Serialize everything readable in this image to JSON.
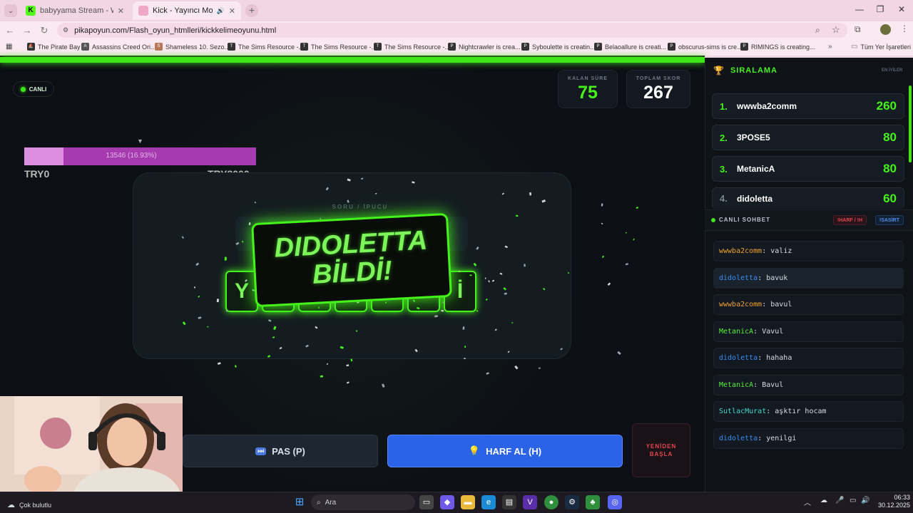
{
  "browser": {
    "tabs": [
      {
        "title": "babyyama Stream - Watch Live",
        "active": false,
        "favicon_color": "#53fc18"
      },
      {
        "title": "Kick - Yayıncı Modu (Kelime",
        "active": true,
        "favicon_color": "#f1a8c8"
      }
    ],
    "url": "pikapoyun.com/Flash_oyun_htmlleri/kickkelimeoyunu.html",
    "bookmarks": [
      {
        "label": "The Pirate Bay",
        "icon": "ship-icon"
      },
      {
        "label": "Assassins Creed Ori...",
        "icon": "creed-icon"
      },
      {
        "label": "Shameless 10. Sezo...",
        "icon": "tv-icon"
      },
      {
        "label": "The Sims Resource -...",
        "icon": "tsr-icon"
      },
      {
        "label": "The Sims Resource -...",
        "icon": "tsr-icon"
      },
      {
        "label": "The Sims Resource -...",
        "icon": "tsr-icon"
      },
      {
        "label": "Nightcrawler is crea...",
        "icon": "patreon-icon"
      },
      {
        "label": "Syboulette is creatin...",
        "icon": "patreon-icon"
      },
      {
        "label": "Belaoallure is creati...",
        "icon": "patreon-icon"
      },
      {
        "label": "obscurus-sims is cre...",
        "icon": "patreon-icon"
      },
      {
        "label": "RIMINGS is creating...",
        "icon": "patreon-icon"
      }
    ],
    "all_bookmarks": "Tüm Yer İşaretleri"
  },
  "game": {
    "live_label": "CANLI",
    "remaining_time": {
      "label": "KALAN SÜRE",
      "value": "75"
    },
    "total_score": {
      "label": "TOPLAM SKOR",
      "value": "267"
    },
    "goal": {
      "text": "13546 (16.93%)",
      "min": "TRY0",
      "max": "TRY8000",
      "progress": 0.1693
    },
    "hint_label": "SORU / İPUCU",
    "letters": [
      "Y",
      "",
      "",
      "",
      "",
      "",
      "İ"
    ],
    "banner": {
      "line1": "DIDOLETTA",
      "line2": "BİLDİ!"
    },
    "pass_button": "PAS (P)",
    "hint_button": "HARF AL (H)",
    "restart_button": {
      "line1": "YENİDEN",
      "line2": "BAŞLA"
    },
    "colors": {
      "accent": "#45f21c",
      "hint_button": "#2a62e8",
      "restart": "#e2464f"
    }
  },
  "leaderboard": {
    "title": "SIRALAMA",
    "subtitle": "EN İYİLER",
    "rows": [
      {
        "rank": "1.",
        "name": "wwwba2comm",
        "score": "260"
      },
      {
        "rank": "2.",
        "name": "3POSE5",
        "score": "80"
      },
      {
        "rank": "3.",
        "name": "MetanicA",
        "score": "80"
      },
      {
        "rank": "4.",
        "name": "didoletta",
        "score": "60"
      }
    ]
  },
  "chat": {
    "title": "CANLI SOHBET",
    "chip1": "!HARF / !H",
    "chip2": "!SASİRT",
    "messages": [
      {
        "user": "wwwba2comm",
        "text": ": valiz",
        "color": "#f0a132"
      },
      {
        "user": "didoletta",
        "text": ": bavuk",
        "color": "#3a8df5"
      },
      {
        "user": "wwwba2comm",
        "text": ": bavul",
        "color": "#f0a132"
      },
      {
        "user": "MetanicA",
        "text": ": Vavul",
        "color": "#58f03a"
      },
      {
        "user": "didoletta",
        "text": ": hahaha",
        "color": "#3a8df5"
      },
      {
        "user": "MetanicA",
        "text": ": Bavul",
        "color": "#58f03a"
      },
      {
        "user": "SutlacMurat",
        "text": ": aşktır hocam",
        "color": "#40d8c8"
      },
      {
        "user": "didoletta",
        "text": ": yenilgi",
        "color": "#3a8df5"
      }
    ]
  },
  "taskbar": {
    "weather": "Çok bulutlu",
    "search": "Ara",
    "time": "06:33",
    "date": "30.12.2025"
  }
}
